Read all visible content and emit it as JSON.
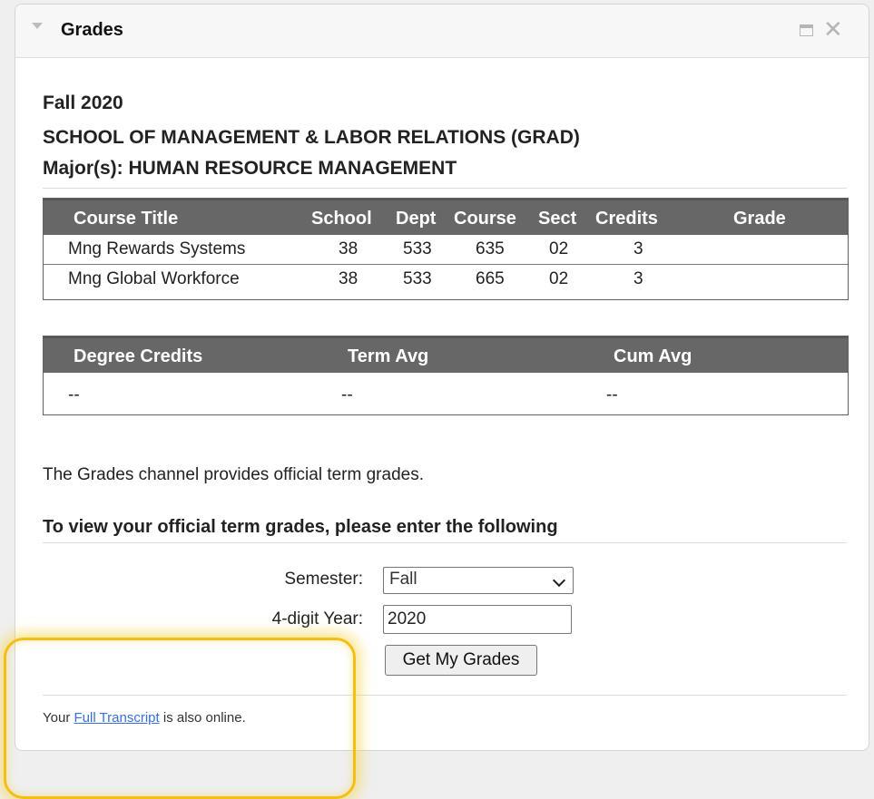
{
  "channel": {
    "title": "Grades",
    "icons": [
      "collapse-triangle-icon",
      "maximize-icon",
      "close-icon"
    ]
  },
  "term": {
    "semester_label": "Fall 2020",
    "school": "SCHOOL OF MANAGEMENT & LABOR RELATIONS (GRAD)",
    "major": "Major(s): HUMAN RESOURCE MANAGEMENT"
  },
  "courses_table": {
    "headers": {
      "title": "Course Title",
      "school": "School",
      "dept": "Dept",
      "course": "Course",
      "sect": "Sect",
      "credits": "Credits",
      "grade": "Grade"
    },
    "rows": [
      {
        "title": "Mng Rewards Systems",
        "school": "38",
        "dept": "533",
        "course": "635",
        "sect": "02",
        "credits": "3",
        "grade": ""
      },
      {
        "title": "Mng Global Workforce",
        "school": "38",
        "dept": "533",
        "course": "665",
        "sect": "02",
        "credits": "3",
        "grade": ""
      }
    ]
  },
  "summary_table": {
    "headers": {
      "degree_credits": "Degree Credits",
      "term_avg": "Term Avg",
      "cum_avg": "Cum Avg"
    },
    "row": {
      "degree_credits": "--",
      "term_avg": "--",
      "cum_avg": "--"
    }
  },
  "description": "The Grades channel provides official term grades.",
  "form": {
    "instruction": "To view your official term grades, please enter the following",
    "semester_label": "Semester:",
    "semester_value": "Fall",
    "year_label": "4-digit Year:",
    "year_value": "2020",
    "submit_label": "Get My Grades"
  },
  "footer": {
    "prefix": "Your ",
    "link_text": "Full Transcript",
    "suffix": " is also online."
  },
  "colors": {
    "table_header_bg": "#676767",
    "link": "#3a6fd8",
    "highlight": "#f3bf17"
  }
}
